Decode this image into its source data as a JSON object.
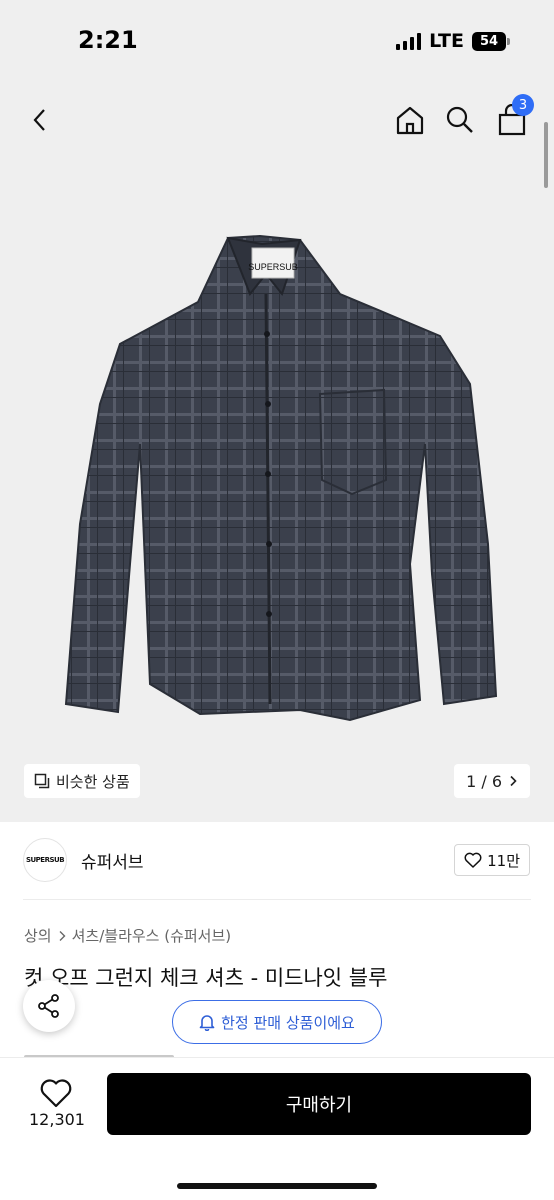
{
  "status_bar": {
    "time": "2:21",
    "network": "LTE",
    "battery": "54"
  },
  "nav": {
    "cart_count": "3",
    "icons": [
      "back-icon",
      "home-icon",
      "search-icon",
      "cart-icon"
    ]
  },
  "gallery": {
    "similar_label": "비슷한 상품",
    "page_indicator": "1 / 6",
    "label_text": "SUPERSUB"
  },
  "brand": {
    "logo_text": "SUPERSUB",
    "name": "슈퍼서브",
    "likes": "11만"
  },
  "product": {
    "breadcrumb": [
      "상의",
      "셔츠/블라우스 (슈퍼서브)"
    ],
    "title": "컷 오프 그런지 체크 셔츠 - 미드나잇 블루"
  },
  "notice": {
    "label": "한정 판매 상품이에요"
  },
  "bottom_bar": {
    "wish_count": "12,301",
    "buy_label": "구매하기"
  },
  "colors": {
    "accent_blue": "#2f6df6",
    "buy_button": "#000000",
    "image_background": "#efefef",
    "shirt": "#3a3f4b"
  }
}
